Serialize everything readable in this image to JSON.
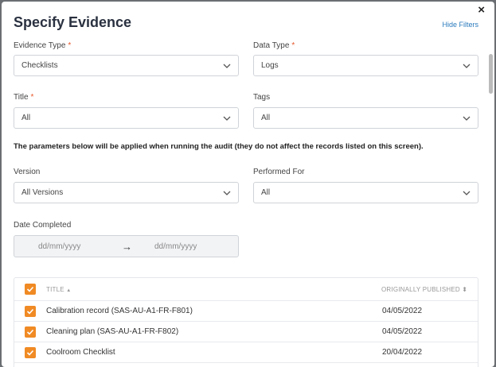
{
  "dialog": {
    "title": "Specify Evidence",
    "close_glyph": "×",
    "hide_filters_label": "Hide Filters"
  },
  "fields": {
    "evidence_type": {
      "label": "Evidence Type",
      "required_mark": "*",
      "value": "Checklists"
    },
    "data_type": {
      "label": "Data Type",
      "required_mark": "*",
      "value": "Logs"
    },
    "title": {
      "label": "Title",
      "required_mark": "*",
      "value": "All"
    },
    "tags": {
      "label": "Tags",
      "value": "All"
    },
    "version": {
      "label": "Version",
      "value": "All Versions"
    },
    "performed_for": {
      "label": "Performed For",
      "value": "All"
    },
    "date_completed": {
      "label": "Date Completed",
      "from_placeholder": "dd/mm/yyyy",
      "to_placeholder": "dd/mm/yyyy",
      "arrow": "→"
    }
  },
  "note": "The parameters below will be applied when running the audit (they do not affect the records listed on this screen).",
  "table": {
    "headers": {
      "title": "TITLE",
      "title_sort": "▲",
      "published": "ORIGINALLY PUBLISHED",
      "published_sort": "⬍"
    },
    "rows": [
      {
        "title": "Calibration record (SAS-AU-A1-FR-F801)",
        "published": "04/05/2022",
        "checked": true
      },
      {
        "title": "Cleaning plan (SAS-AU-A1-FR-F802)",
        "published": "04/05/2022",
        "checked": true
      },
      {
        "title": "Coolroom Checklist",
        "published": "20/04/2022",
        "checked": true
      }
    ]
  },
  "colors": {
    "accent": "#f08a24",
    "link": "#2b7bbd",
    "required": "#e8572a",
    "title": "#2a3140"
  },
  "icons": {
    "dropdown": "chevron-down-icon",
    "checkbox": "check-icon",
    "close": "close-icon"
  }
}
